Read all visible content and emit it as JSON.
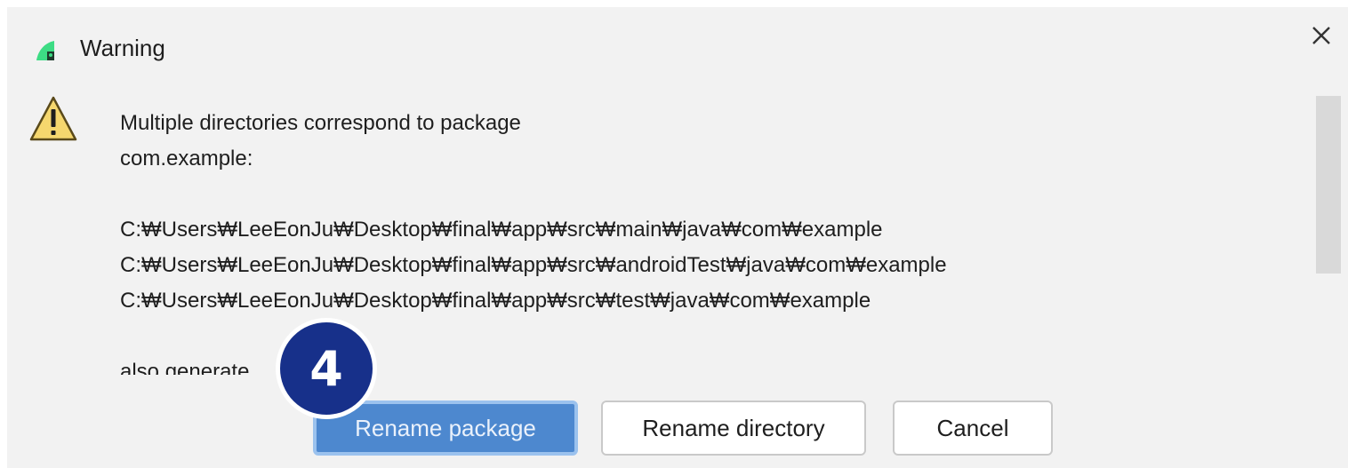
{
  "dialog": {
    "title": "Warning",
    "close_icon": "close-icon",
    "title_icon": "android-studio-icon",
    "warning_icon": "warning-triangle-icon"
  },
  "message": {
    "lines": [
      "Multiple directories correspond to package",
      "com.example:",
      "",
      "C:₩Users₩LeeEonJu₩Desktop₩final₩app₩src₩main₩java₩com₩example",
      "C:₩Users₩LeeEonJu₩Desktop₩final₩app₩src₩androidTest₩java₩com₩example",
      "C:₩Users₩LeeEonJu₩Desktop₩final₩app₩src₩test₩java₩com₩example",
      "",
      "also generate"
    ]
  },
  "buttons": {
    "rename_package": "Rename package",
    "rename_directory": "Rename directory",
    "cancel": "Cancel"
  },
  "annotation": {
    "step_number": "4"
  },
  "colors": {
    "dialog_bg": "#f2f2f2",
    "primary_button": "#4d88cf",
    "step_badge": "#17308a",
    "warning_fill": "#f5d76e"
  }
}
